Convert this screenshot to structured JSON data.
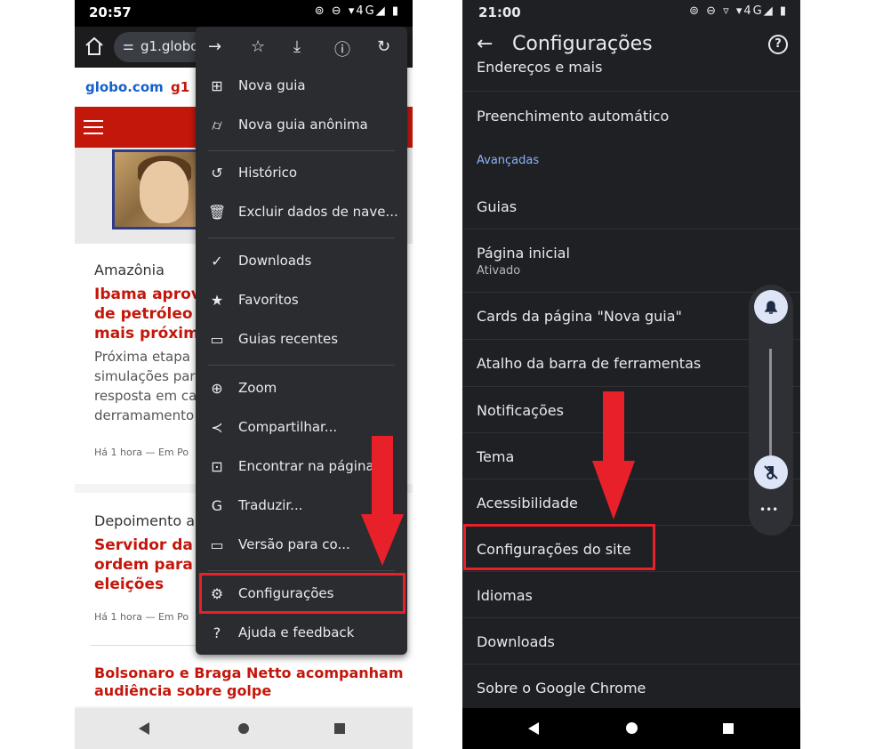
{
  "left": {
    "status": {
      "time": "20:57",
      "icons": "⊚ ⊖ ▾4G◢ ▮"
    },
    "toolbar": {
      "url": "g1.globo.",
      "tune_icon": "tune-icon"
    },
    "site": {
      "globo": "globo.com",
      "g1": "g1"
    },
    "article1": {
      "section": "Amazônia",
      "headline": [
        "Ibama aprov",
        "de petróleo r",
        "mais próxima"
      ],
      "body": [
        "Próxima etapa",
        "simulações par",
        "resposta em ca",
        "derramamento"
      ],
      "meta": "Há 1 hora — Em Po"
    },
    "article2": {
      "section": "Depoimento a",
      "headline": [
        "Servidor da P",
        "ordem para b",
        "eleições"
      ],
      "meta": "Há 1 hora — Em Po"
    },
    "article3": {
      "headline": [
        "Bolsonaro e Braga Netto acompanham",
        "audiência sobre golpe"
      ]
    },
    "menu": {
      "items": [
        {
          "icon": "⊞",
          "label": "Nova guia"
        },
        {
          "icon": "⌭",
          "label": "Nova guia anônima"
        },
        {
          "icon": "↺",
          "label": "Histórico"
        },
        {
          "icon": "🗑",
          "label": "Excluir dados de nave..."
        },
        {
          "icon": "✓",
          "label": "Downloads"
        },
        {
          "icon": "★",
          "label": "Favoritos"
        },
        {
          "icon": "▭",
          "label": "Guias recentes"
        },
        {
          "icon": "⊕",
          "label": "Zoom"
        },
        {
          "icon": "≺",
          "label": "Compartilhar..."
        },
        {
          "icon": "⊡",
          "label": "Encontrar na página"
        },
        {
          "icon": "G",
          "label": "Traduzir..."
        },
        {
          "icon": "▭",
          "label": "Versão para co..."
        },
        {
          "icon": "⚙",
          "label": "Configurações"
        },
        {
          "icon": "?",
          "label": "Ajuda e feedback"
        }
      ]
    }
  },
  "right": {
    "status": {
      "time": "21:00",
      "icons": "⊚ ⊖ ▿ ▾4G◢ ▮"
    },
    "app_title": "Configurações",
    "help": "?",
    "items": {
      "enderecos": "Endereços e mais",
      "preenchimento": "Preenchimento automático",
      "section": "Avançadas",
      "guias": "Guias",
      "pagina_inicial": "Página inicial",
      "pagina_inicial_sub": "Ativado",
      "cards": "Cards da página \"Nova guia\"",
      "atalho": "Atalho da barra de ferramentas",
      "notificacoes": "Notificações",
      "tema": "Tema",
      "acessibilidade": "Acessibilidade",
      "config_site": "Configurações do site",
      "idiomas": "Idiomas",
      "downloads": "Downloads",
      "sobre": "Sobre o Google Chrome"
    },
    "volume_more": "•••"
  },
  "colors": {
    "accent_red": "#e8202a",
    "g1_red": "#c4170c",
    "link_blue": "#8ab4f8"
  }
}
